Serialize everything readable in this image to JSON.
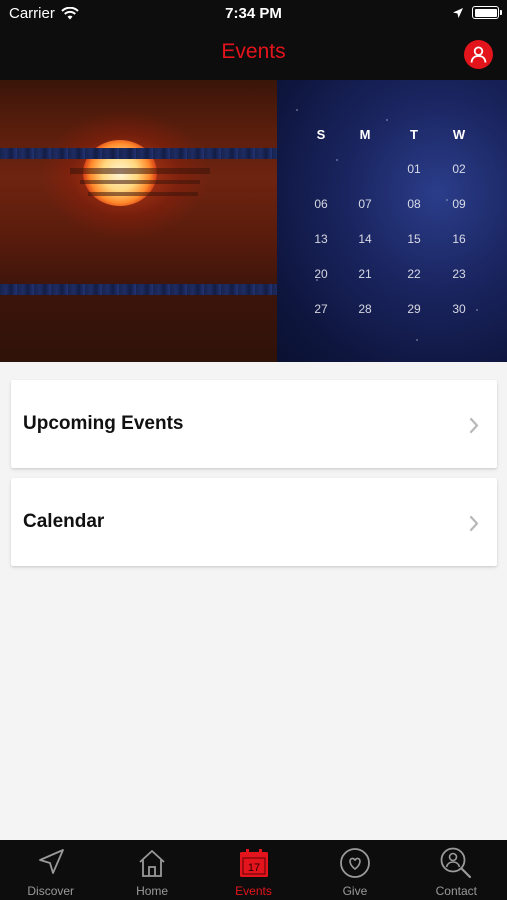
{
  "status_bar": {
    "carrier": "Carrier",
    "time": "7:34 PM"
  },
  "nav": {
    "title": "Events",
    "accent_color": "#e3141b"
  },
  "hero": {
    "weekdays": [
      "S",
      "M",
      "T",
      "W"
    ],
    "days": [
      "01",
      "02",
      "06",
      "07",
      "08",
      "09",
      "13",
      "14",
      "15",
      "16",
      "20",
      "21",
      "22",
      "23",
      "27",
      "28",
      "29",
      "30"
    ]
  },
  "list": {
    "items": [
      {
        "label": "Upcoming Events",
        "icon": "chevron-right-icon"
      },
      {
        "label": "Calendar",
        "icon": "chevron-right-icon"
      }
    ]
  },
  "tab_bar": {
    "active_index": 2,
    "tabs": [
      {
        "label": "Discover",
        "icon": "navigation-arrow-icon"
      },
      {
        "label": "Home",
        "icon": "home-icon"
      },
      {
        "label": "Events",
        "icon": "calendar-icon",
        "icon_text": "17"
      },
      {
        "label": "Give",
        "icon": "heart-icon"
      },
      {
        "label": "Contact",
        "icon": "contact-search-icon"
      }
    ]
  }
}
